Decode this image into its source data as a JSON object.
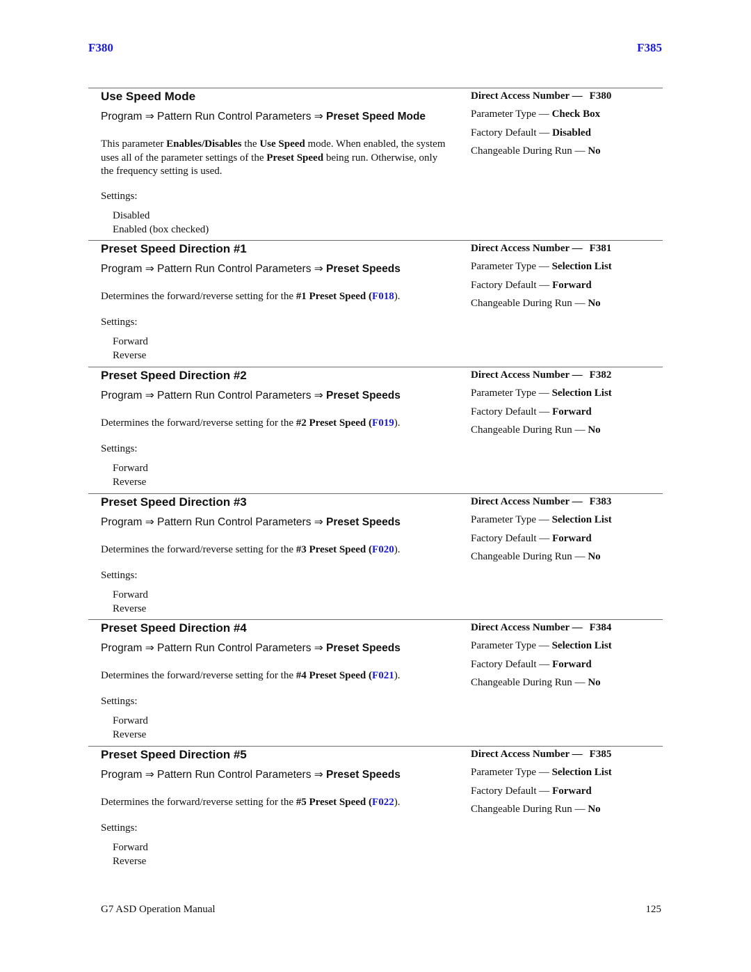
{
  "header": {
    "left_code": "F380",
    "right_code": "F385"
  },
  "sections": [
    {
      "title": "Use Speed Mode",
      "path": {
        "prefix": "Program ⇒ Pattern Run Control Parameters ⇒ ",
        "target": "Preset Speed Mode"
      },
      "description": {
        "t1": "This parameter ",
        "b1": "Enables/Disables",
        "t2": " the ",
        "b2": "Use Speed",
        "t3": " mode. When enabled, the system uses all of the parameter settings of the ",
        "b3": "Preset Speed",
        "t4": " being run. Otherwise, only the frequency setting is used."
      },
      "settings_label": "Settings:",
      "settings": [
        "Disabled",
        "Enabled (box checked)"
      ],
      "meta": {
        "direct_access_label": "Direct Access Number —",
        "direct_access_number": "F380",
        "param_type_label": "Parameter Type — ",
        "param_type": "Check Box",
        "factory_default_label": "Factory Default — ",
        "factory_default": "Disabled",
        "changeable_label": "Changeable During Run — ",
        "changeable": "No"
      }
    },
    {
      "title": "Preset Speed Direction #1",
      "path": {
        "prefix": "Program ⇒ Pattern Run Control Parameters ⇒ ",
        "target": "Preset Speeds"
      },
      "description": {
        "text": "Determines the forward/reverse setting for the ",
        "bold": "#1 Preset Speed",
        "open": " (",
        "link": "F018",
        "close": ")."
      },
      "settings_label": "Settings:",
      "settings": [
        "Forward",
        "Reverse"
      ],
      "meta": {
        "direct_access_label": "Direct Access Number —",
        "direct_access_number": "F381",
        "param_type_label": "Parameter Type — ",
        "param_type": "Selection List",
        "factory_default_label": "Factory Default — ",
        "factory_default": "Forward",
        "changeable_label": "Changeable During Run — ",
        "changeable": "No"
      }
    },
    {
      "title": "Preset Speed Direction #2",
      "path": {
        "prefix": "Program ⇒ Pattern Run Control Parameters ⇒ ",
        "target": "Preset Speeds"
      },
      "description": {
        "text": "Determines the forward/reverse setting for the ",
        "bold": "#2 Preset Speed",
        "open": " (",
        "link": "F019",
        "close": ")."
      },
      "settings_label": "Settings:",
      "settings": [
        "Forward",
        "Reverse"
      ],
      "meta": {
        "direct_access_label": "Direct Access Number —",
        "direct_access_number": "F382",
        "param_type_label": "Parameter Type — ",
        "param_type": "Selection List",
        "factory_default_label": "Factory Default — ",
        "factory_default": "Forward",
        "changeable_label": "Changeable During Run — ",
        "changeable": "No"
      }
    },
    {
      "title": "Preset Speed Direction #3",
      "path": {
        "prefix": "Program ⇒ Pattern Run Control Parameters ⇒ ",
        "target": "Preset Speeds"
      },
      "description": {
        "text": "Determines the forward/reverse setting for the ",
        "bold": "#3 Preset Speed",
        "open": " (",
        "link": "F020",
        "close": ")."
      },
      "settings_label": "Settings:",
      "settings": [
        "Forward",
        "Reverse"
      ],
      "meta": {
        "direct_access_label": "Direct Access Number —",
        "direct_access_number": "F383",
        "param_type_label": "Parameter Type — ",
        "param_type": "Selection List",
        "factory_default_label": "Factory Default — ",
        "factory_default": "Forward",
        "changeable_label": "Changeable During Run — ",
        "changeable": "No"
      }
    },
    {
      "title": "Preset Speed Direction #4",
      "path": {
        "prefix": "Program ⇒ Pattern Run Control Parameters ⇒ ",
        "target": "Preset Speeds"
      },
      "description": {
        "text": "Determines the forward/reverse setting for the ",
        "bold": "#4 Preset Speed",
        "open": " (",
        "link": "F021",
        "close": ")."
      },
      "settings_label": "Settings:",
      "settings": [
        "Forward",
        "Reverse"
      ],
      "meta": {
        "direct_access_label": "Direct Access Number —",
        "direct_access_number": "F384",
        "param_type_label": "Parameter Type — ",
        "param_type": "Selection List",
        "factory_default_label": "Factory Default — ",
        "factory_default": "Forward",
        "changeable_label": "Changeable During Run — ",
        "changeable": "No"
      }
    },
    {
      "title": "Preset Speed Direction #5",
      "path": {
        "prefix": "Program ⇒ Pattern Run Control Parameters ⇒ ",
        "target": "Preset Speeds"
      },
      "description": {
        "text": "Determines the forward/reverse setting for the ",
        "bold": "#5 Preset Speed",
        "open": " (",
        "link": "F022",
        "close": ")."
      },
      "settings_label": "Settings:",
      "settings": [
        "Forward",
        "Reverse"
      ],
      "meta": {
        "direct_access_label": "Direct Access Number —",
        "direct_access_number": "F385",
        "param_type_label": "Parameter Type — ",
        "param_type": "Selection List",
        "factory_default_label": "Factory Default — ",
        "factory_default": "Forward",
        "changeable_label": "Changeable During Run — ",
        "changeable": "No"
      }
    }
  ],
  "footer": {
    "manual_title": "G7 ASD Operation Manual",
    "page_number": "125"
  },
  "colors": {
    "link": "#1a1adc",
    "rule": "#6b6b6b",
    "text": "#111111"
  }
}
